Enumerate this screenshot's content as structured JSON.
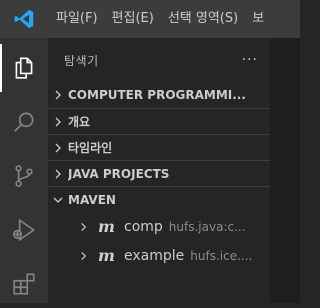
{
  "menubar": {
    "items": [
      "파일(F)",
      "편집(E)",
      "선택 영역(S)",
      "보"
    ]
  },
  "activity_bar": {
    "icons": [
      "explorer-icon",
      "search-icon",
      "source-control-icon",
      "run-debug-icon",
      "extensions-icon"
    ]
  },
  "sidebar": {
    "title": "탐색기",
    "more_label": "···",
    "sections": [
      {
        "label": "COMPUTER PROGRAMMI...",
        "expanded": false
      },
      {
        "label": "개요",
        "expanded": false
      },
      {
        "label": "타임라인",
        "expanded": false
      },
      {
        "label": "JAVA PROJECTS",
        "expanded": false
      },
      {
        "label": "MAVEN",
        "expanded": true
      }
    ],
    "maven_projects": [
      {
        "name": "comp",
        "description": "hufs.java:c..."
      },
      {
        "name": "example",
        "description": "hufs.ice...."
      }
    ]
  },
  "colors": {
    "titlebar_bg": "#3c3c3c",
    "activitybar_bg": "#333333",
    "sidebar_bg": "#252526",
    "vscode_blue": "#23a9f2"
  }
}
